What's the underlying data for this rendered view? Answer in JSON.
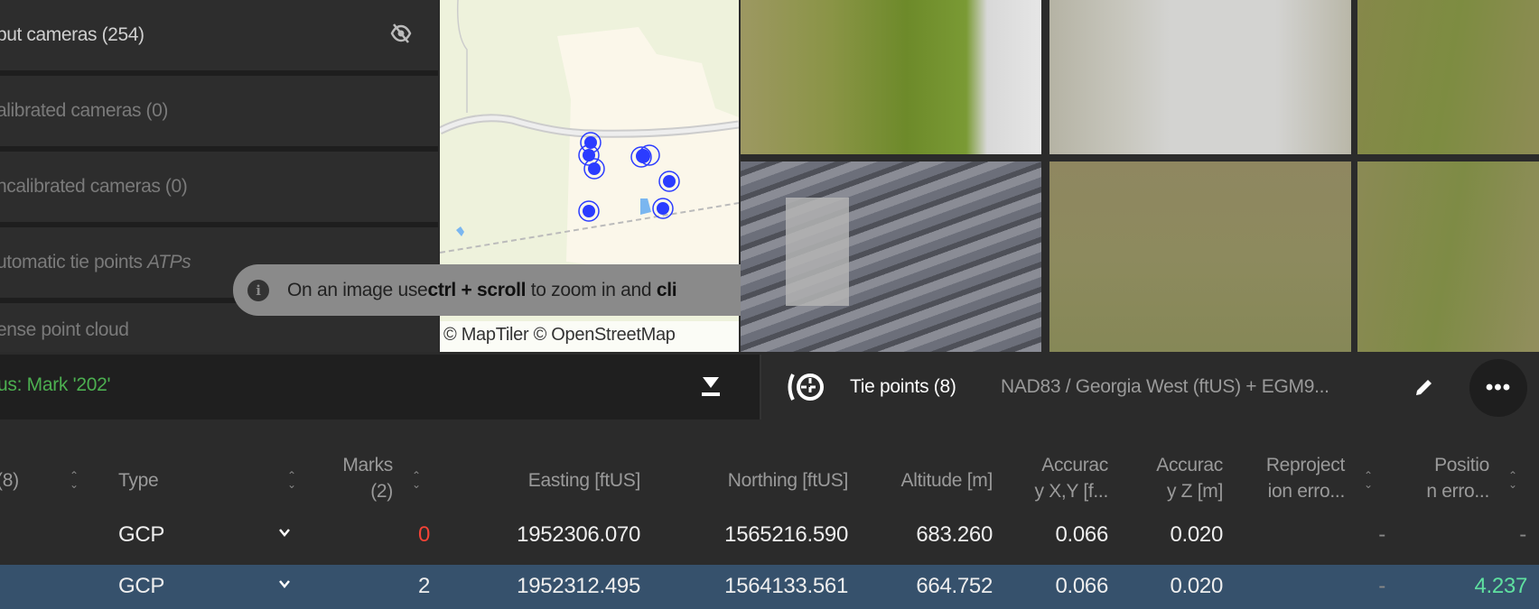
{
  "layers": [
    {
      "label": "put cameras (254)",
      "active": true,
      "icon": "eye-off-icon"
    },
    {
      "label": "alibrated cameras (0)"
    },
    {
      "label": "ncalibrated cameras (0)"
    },
    {
      "label": "utomatic tie points ",
      "italic": "ATPs"
    },
    {
      "label": "ense point cloud"
    }
  ],
  "map": {
    "attribution": "© MapTiler  © OpenStreetMap",
    "marker_color": "#2b3cff"
  },
  "tooltip": {
    "pre": "On an image use ",
    "bold1": "ctrl + scroll",
    "mid": " to zoom in and ",
    "bold2": "cli"
  },
  "status": {
    "text": "us: Mark '202'",
    "color": "#4caf50"
  },
  "tiepoints": {
    "title": "Tie points (8)",
    "crs": "NAD83 / Georgia West (ftUS) + EGM9..."
  },
  "table": {
    "headers": {
      "name": "(8)",
      "type": "Type",
      "marks1": "Marks",
      "marks2": "(2)",
      "easting": "Easting [ftUS]",
      "northing": "Northing [ftUS]",
      "altitude": "Altitude [m]",
      "accxy1": "Accurac",
      "accxy2": "y X,Y [f...",
      "accz1": "Accurac",
      "accz2": "y Z [m]",
      "reproj1": "Reproject",
      "reproj2": "ion erro...",
      "pos1": "Positio",
      "pos2": "n erro..."
    },
    "rows": [
      {
        "type": "GCP",
        "marks": "0",
        "easting": "1952306.070",
        "northing": "1565216.590",
        "altitude": "683.260",
        "accxy": "0.066",
        "accz": "0.020",
        "reproj": "-",
        "pos": "-",
        "selected": false
      },
      {
        "type": "GCP",
        "marks": "2",
        "easting": "1952312.495",
        "northing": "1564133.561",
        "altitude": "664.752",
        "accxy": "0.066",
        "accz": "0.020",
        "reproj": "-",
        "pos": "4.237",
        "selected": true
      }
    ]
  }
}
